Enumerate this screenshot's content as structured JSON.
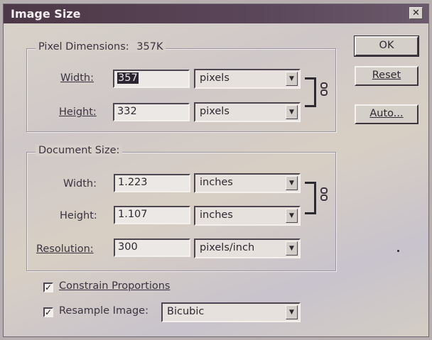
{
  "dialog": {
    "title": "Image Size",
    "close_glyph": "✕"
  },
  "buttons": {
    "ok": "OK",
    "reset": "Reset",
    "auto": "Auto..."
  },
  "pixel_dimensions": {
    "legend": "Pixel Dimensions:",
    "size": "357K",
    "width_label": "Width:",
    "width_value": "357",
    "width_unit": "pixels",
    "height_label": "Height:",
    "height_value": "332",
    "height_unit": "pixels"
  },
  "document_size": {
    "legend": "Document Size:",
    "width_label": "Width:",
    "width_value": "1.223",
    "width_unit": "inches",
    "height_label": "Height:",
    "height_value": "1.107",
    "height_unit": "inches",
    "resolution_label": "Resolution:",
    "resolution_value": "300",
    "resolution_unit": "pixels/inch"
  },
  "options": {
    "constrain_label": "Constrain Proportions",
    "constrain_checked": true,
    "resample_label": "Resample Image:",
    "resample_checked": true,
    "resample_method": "Bicubic"
  },
  "icons": {
    "checkmark": "✓",
    "dropdown_arrow": "▼"
  }
}
